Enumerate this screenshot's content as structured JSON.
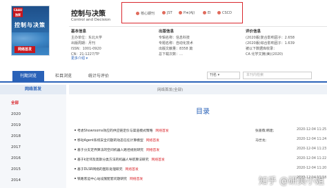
{
  "cover": {
    "badge": "CAAU 独家",
    "title": "控制与决策",
    "footer": "网络首发"
  },
  "journal": {
    "title_cn": "控制与决策",
    "title_en": "Control and Decision"
  },
  "tags": [
    "核心期刊",
    "JST",
    "Pж(AJ)",
    "EI",
    "CSCD"
  ],
  "sections": {
    "basic": {
      "heading": "基本信息",
      "rows": [
        "主办单位：东北大学",
        "出版周期：月刊",
        "ISSN：1001-0920",
        "CN：21-1227/TP"
      ]
    },
    "publish": {
      "heading": "出版信息",
      "rows": [
        "专辑名称：信息科技",
        "专题名称：自动化技术",
        "出版文献量：8358 篇",
        "总下载次数：…"
      ]
    },
    "eval": {
      "heading": "评价信息",
      "rows": [
        "(2020版)复合影响因子：2.658",
        "(2020版)综合影响因子：1.639",
        "被以下数据库收录：",
        "CA 化学文摘(美)(2020)"
      ]
    }
  },
  "more": "更多介绍 ▾",
  "tabs": [
    "刊期浏览",
    "栏目浏览",
    "统计与评价"
  ],
  "search": {
    "select": "刊名 ▾",
    "placeholder": "本刊内检索"
  },
  "sidebar": {
    "heading": "网络首发",
    "years": [
      "全部",
      "2020",
      "2019",
      "2018",
      "2017",
      "2016",
      "2015",
      "2014"
    ]
  },
  "main_header": "网络首发(全部)",
  "list_title": "目录",
  "rows": [
    {
      "title": "考虑Showrooms效应的供应链定价与渠道模式策略",
      "tag": "网络首发",
      "author": "张蔷薇;韩建;",
      "date": "2020-12-04 11:25"
    },
    {
      "title": "移动Agent系统安全问题的动态信任计算模型",
      "tag": "网络首发",
      "author": "马世龙;",
      "date": "2020-12-04 11:24"
    },
    {
      "title": "基于分支定界算法的空间机器人路径规划研究",
      "tag": "网络首发",
      "author": "",
      "date": "2020-12-04 11:23"
    },
    {
      "title": "基于k近邻及高斯分类方法的机器人导航算法研究",
      "tag": "网络首发",
      "author": "",
      "date": "2020-12-04 11:22"
    },
    {
      "title": "基于DLSR网络的图形处理研究",
      "tag": "网络首发",
      "author": "",
      "date": "2020-12-04 11:20"
    },
    {
      "title": "铁路客运中心站设施配套问题研究",
      "tag": "网络首发",
      "author": "",
      "date": "2020-12-04 11:18"
    }
  ],
  "watermark": "知乎 @研美小姐"
}
